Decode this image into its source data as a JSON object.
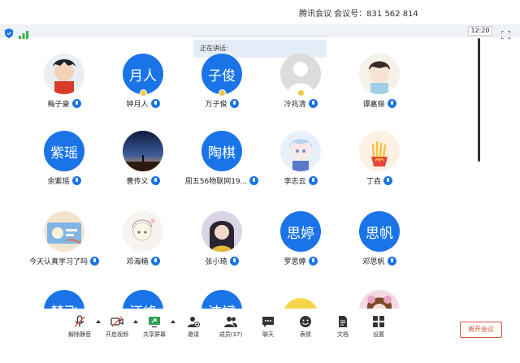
{
  "window": {
    "title": "腾讯会议 会议号：831 562 814"
  },
  "status": {
    "clock": "12:20"
  },
  "speaking": {
    "label": "正在讲话:"
  },
  "participants": [
    {
      "name": "梅子豪",
      "avatar_text": "",
      "avatar_kind": "photo",
      "mic": true
    },
    {
      "name": "钟月人",
      "avatar_text": "月人",
      "avatar_kind": "text",
      "mic": true
    },
    {
      "name": "万子俊",
      "avatar_text": "子俊",
      "avatar_kind": "text",
      "mic": true
    },
    {
      "name": "冷兆清",
      "avatar_text": "",
      "avatar_kind": "default",
      "mic": true
    },
    {
      "name": "谭嘉俪",
      "avatar_text": "",
      "avatar_kind": "photo",
      "mic": true
    },
    {
      "name": "余紫瑶",
      "avatar_text": "紫瑶",
      "avatar_kind": "text",
      "mic": true
    },
    {
      "name": "曹传义",
      "avatar_text": "",
      "avatar_kind": "photo",
      "mic": true
    },
    {
      "name": "周五56物联网19...",
      "avatar_text": "陶棋",
      "avatar_kind": "text",
      "mic": true
    },
    {
      "name": "李志云",
      "avatar_text": "",
      "avatar_kind": "photo",
      "mic": true
    },
    {
      "name": "丁垚",
      "avatar_text": "",
      "avatar_kind": "photo",
      "mic": false
    },
    {
      "name": "今天认真学习了吗",
      "avatar_text": "",
      "avatar_kind": "photo",
      "mic": true
    },
    {
      "name": "邓海楠",
      "avatar_text": "",
      "avatar_kind": "photo",
      "mic": true
    },
    {
      "name": "张小琦",
      "avatar_text": "",
      "avatar_kind": "photo",
      "mic": true
    },
    {
      "name": "罗思婷",
      "avatar_text": "思婷",
      "avatar_kind": "text",
      "mic": true
    },
    {
      "name": "邓思帆",
      "avatar_text": "思帆",
      "avatar_kind": "text",
      "mic": true
    },
    {
      "name": "",
      "avatar_text": "楚飞",
      "avatar_kind": "text",
      "mic": false
    },
    {
      "name": "",
      "avatar_text": "汪峰",
      "avatar_kind": "text",
      "mic": false
    },
    {
      "name": "",
      "avatar_text": "洁斌",
      "avatar_kind": "text",
      "mic": false
    },
    {
      "name": "",
      "avatar_text": "",
      "avatar_kind": "photo",
      "mic": false
    },
    {
      "name": "",
      "avatar_text": "",
      "avatar_kind": "photo",
      "mic": false
    }
  ],
  "toolbar": {
    "mute": "解除静音",
    "video": "开启视频",
    "share": "共享屏幕",
    "invite": "邀请",
    "members": "成员(37)",
    "chat": "聊天",
    "reaction": "表情",
    "docs": "文档",
    "settings": "设置",
    "leave": "离开会议"
  },
  "colors": {
    "accent": "#1a74e8",
    "leave": "#e0523b",
    "status_bar": "#eef1f5"
  }
}
